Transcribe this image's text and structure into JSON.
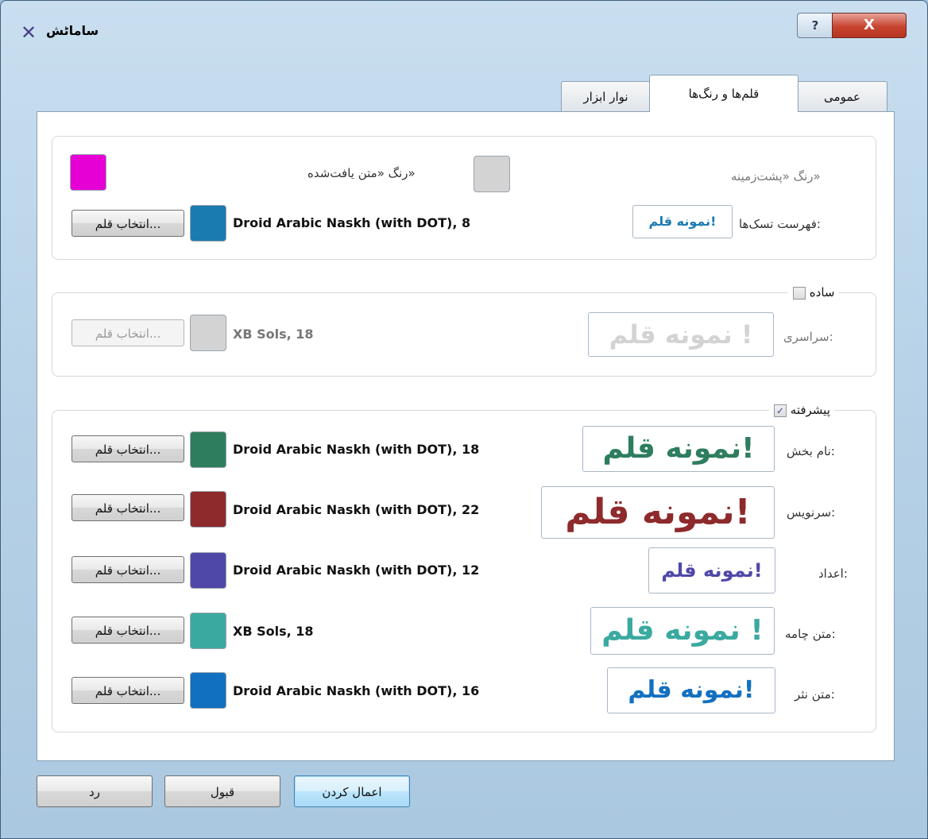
{
  "window": {
    "title": "ساماٹش",
    "help_label": "?",
    "close_label": "X"
  },
  "tabs": [
    {
      "label": "عمومی"
    },
    {
      "label": "قلم‌ها و رنگ‌ها",
      "active": true
    },
    {
      "label": "نوار ابزار"
    }
  ],
  "colors_group": {
    "background_color_label": "رنگ «پشت‌زمینه»",
    "found_text_color_label": "رنگ «متن یافت‌شده»",
    "found_text_color": "#d3d3d3",
    "accent_swatch_color": "#e600d6",
    "tasklist_label": "فهرست تسک‌ها:",
    "tasklist_sample": "نمونه قلم!",
    "tasklist_font": "Droid Arabic Naskh (with DOT), 8",
    "tasklist_color": "#1a7bb0",
    "tasklist_button": "انتخاب قلم..."
  },
  "simple_group": {
    "title": "ساده",
    "checked": false,
    "global_label": "سراسری:",
    "global_sample": "نمونه قلم !",
    "global_font": "XB Sols, 18",
    "global_color": "#d3d3d3",
    "global_button": "انتخاب قلم..."
  },
  "advanced_group": {
    "title": "پیشرفته",
    "checked": true,
    "check_mark": "✓",
    "rows": [
      {
        "label": "نام بخش:",
        "sample": "نمونه قلم!",
        "font": "Droid Arabic Naskh (with DOT), 18",
        "color": "#2e7d5e",
        "button": "انتخاب قلم..."
      },
      {
        "label": "سرنویس:",
        "sample": "نمونه قلم!",
        "font": "Droid Arabic Naskh (with DOT), 22",
        "color": "#8e2a2c",
        "button": "انتخاب قلم..."
      },
      {
        "label": "اعداد:",
        "sample": "نمونه قلم!",
        "font": "Droid Arabic Naskh (with DOT), 12",
        "color": "#5048a8",
        "button": "انتخاب قلم..."
      },
      {
        "label": "متن چامه:",
        "sample": "نمونه قلم !",
        "font": "XB Sols, 18",
        "color": "#3aaaa0",
        "button": "انتخاب قلم..."
      },
      {
        "label": "متن نثر:",
        "sample": "نمونه قلم!",
        "font": "Droid Arabic Naskh (with DOT), 16",
        "color": "#1270c0",
        "button": "انتخاب قلم..."
      }
    ]
  },
  "footer": {
    "apply": "اعمال کردن",
    "ok": "قبول",
    "cancel": "رد"
  }
}
